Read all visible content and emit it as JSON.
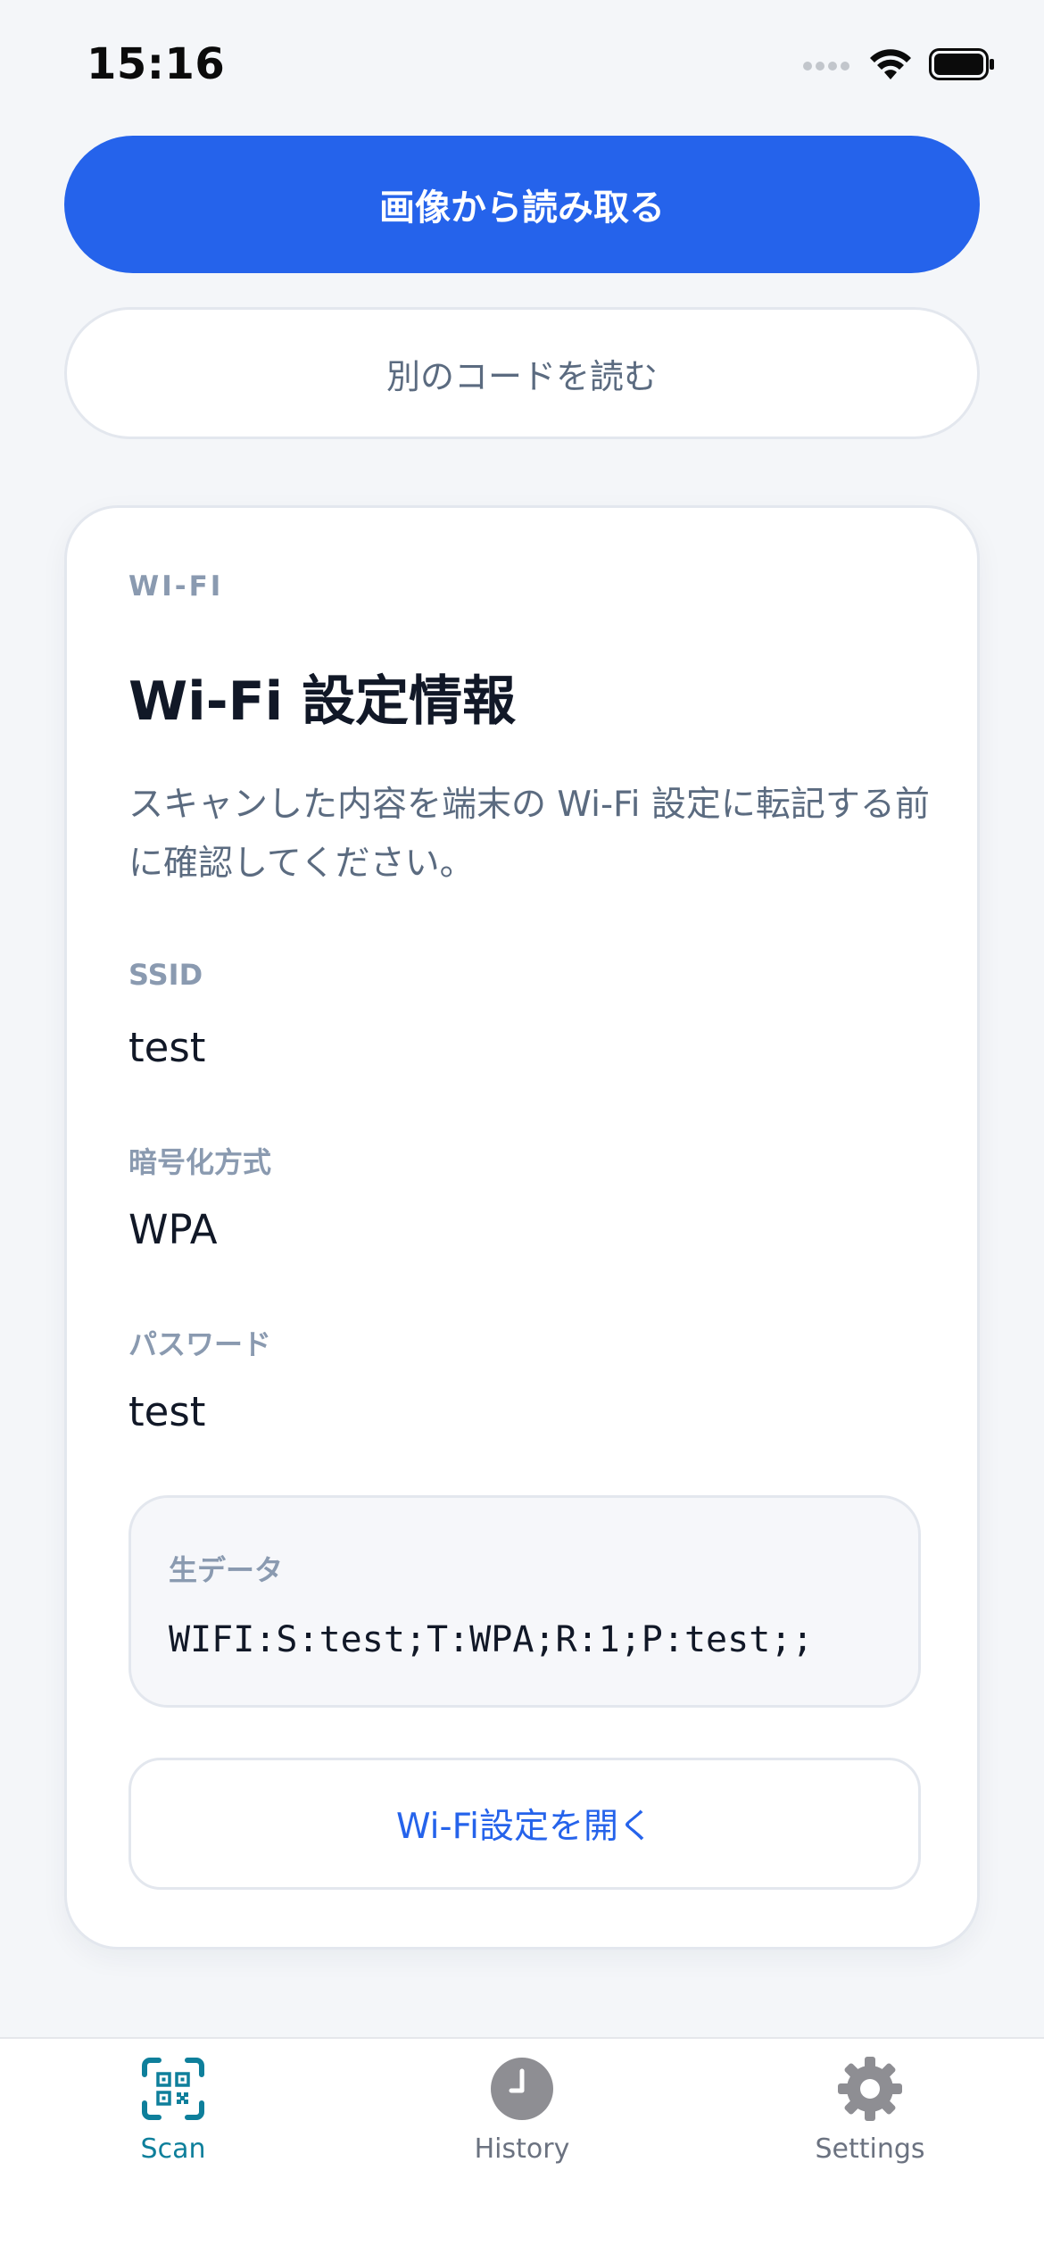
{
  "status_bar": {
    "time": "15:16"
  },
  "actions": {
    "read_from_image": "画像から読み取る",
    "scan_another": "別のコードを読む"
  },
  "card": {
    "kicker": "WI-FI",
    "title": "Wi-Fi 設定情報",
    "description": "スキャンした内容を端末の Wi-Fi 設定に転記する前に確認してください。",
    "fields": [
      {
        "label": "SSID",
        "value": "test"
      },
      {
        "label": "暗号化方式",
        "value": "WPA"
      },
      {
        "label": "パスワード",
        "value": "test"
      }
    ],
    "raw": {
      "label": "生データ",
      "value": "WIFI:S:test;T:WPA;R:1;P:test;;"
    },
    "open_settings": "Wi-Fi設定を開く"
  },
  "tabs": [
    {
      "label": "Scan",
      "icon": "qr-scan-icon",
      "active": true
    },
    {
      "label": "History",
      "icon": "clock-icon",
      "active": false
    },
    {
      "label": "Settings",
      "icon": "gear-icon",
      "active": false
    }
  ],
  "colors": {
    "accent": "#2563eb",
    "active_tab": "#0e7f9b",
    "background": "#f4f6f9",
    "muted_label": "#8a9ab0"
  }
}
